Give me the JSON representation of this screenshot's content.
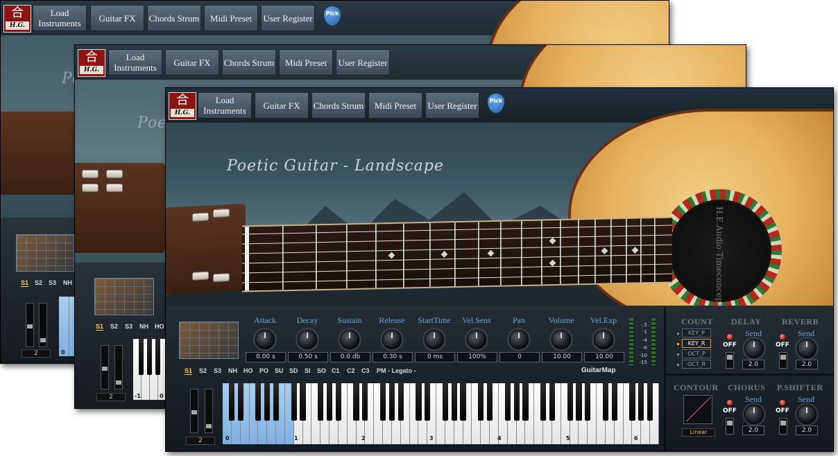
{
  "logo": {
    "glyph": "合",
    "brand": "H.G."
  },
  "menu": {
    "load": "Load Instruments",
    "guitarfx": "Guitar FX",
    "chords": "Chords Strum",
    "midi": "Midi Preset",
    "user": "User Register",
    "pick": "Pick"
  },
  "instrument_title": "Poetic Guitar - Landscape",
  "soundhole_label": "H.E.Audio Timeconcept",
  "knobs": [
    {
      "label": "Attack",
      "value": "0.00 s"
    },
    {
      "label": "Decay",
      "value": "0.50 s"
    },
    {
      "label": "Sustain",
      "value": "0.0 db"
    },
    {
      "label": "Release",
      "value": "0.30 s"
    },
    {
      "label": "StartTime",
      "value": "0 ms"
    },
    {
      "label": "Vel.Sens",
      "value": "100%"
    },
    {
      "label": "Pan",
      "value": "0"
    },
    {
      "label": "Volume",
      "value": "10.00"
    },
    {
      "label": "Vel.Exp",
      "value": "10.00"
    }
  ],
  "keyswitches": [
    "S1",
    "S2",
    "S3",
    "NH",
    "HO",
    "PO",
    "SU",
    "SD",
    "SI",
    "SO",
    "C1",
    "C2",
    "C3",
    "PM - Legato -"
  ],
  "keyswitches_short": [
    "S1",
    "S2",
    "S3",
    "NH"
  ],
  "keyswitches_mid": [
    "S1",
    "S2",
    "S3",
    "NH",
    "HO"
  ],
  "guitarmap": "GuitarMap",
  "meter_scale": [
    "-.5",
    "-1",
    "-4",
    "-6",
    "-10",
    "-15"
  ],
  "fx": {
    "count": "COUNT",
    "delay": "DELAY",
    "reverb": "REVERB",
    "contour": "CONTOUR",
    "chorus": "CHORUS",
    "pshifter": "P.SHIFTER",
    "send": "Send",
    "off": "OFF",
    "delay_send": "2.0",
    "reverb_send": "2.0",
    "chorus_send": "2.0",
    "pshifter_send": "2.0",
    "count_items": [
      "KEY_P",
      "KEY_R",
      "OCT_P",
      "OCT_R"
    ],
    "contour_mode": "Linear"
  },
  "octave": {
    "value": "2",
    "labels": [
      "0",
      "1",
      "2",
      "3",
      "4",
      "5",
      "6"
    ],
    "mid_labels": [
      "-1",
      "0"
    ],
    "back_labels": [
      "0"
    ]
  }
}
